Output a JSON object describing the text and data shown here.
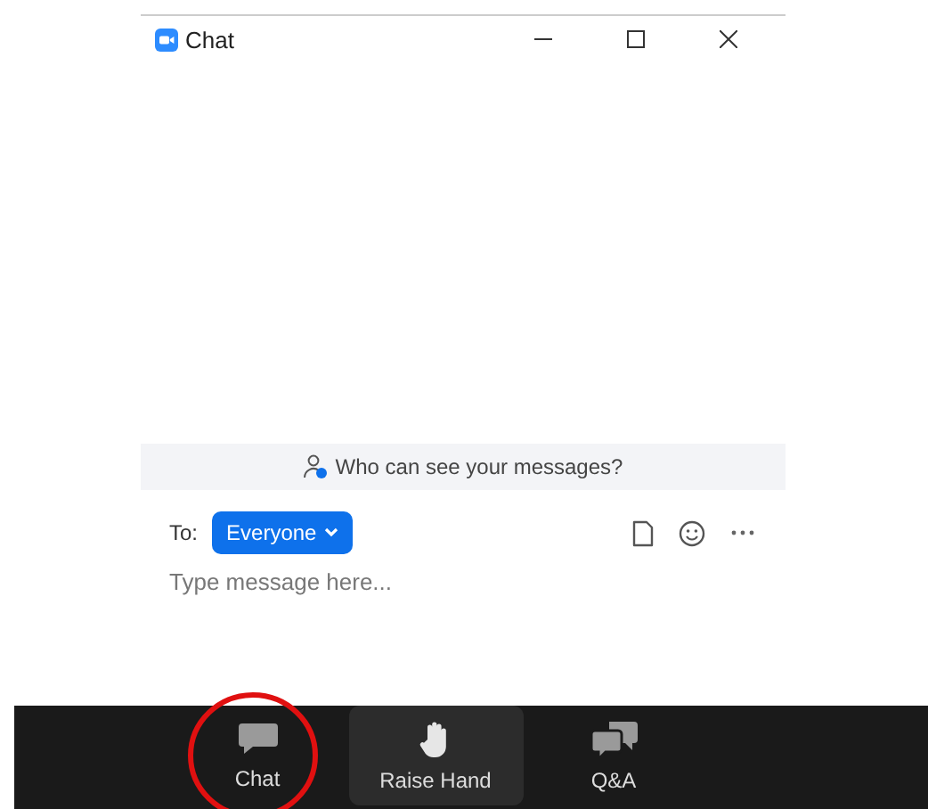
{
  "window": {
    "title": "Chat"
  },
  "privacy_notice": "Who can see your messages?",
  "compose": {
    "to_label": "To:",
    "recipient": "Everyone",
    "placeholder": "Type message here..."
  },
  "toolbar": [
    {
      "kind": "chat",
      "label": "Chat",
      "highlighted": false,
      "circled": true
    },
    {
      "kind": "hand",
      "label": "Raise Hand",
      "highlighted": true,
      "circled": false
    },
    {
      "kind": "qa",
      "label": "Q&A",
      "highlighted": false,
      "circled": false
    }
  ]
}
